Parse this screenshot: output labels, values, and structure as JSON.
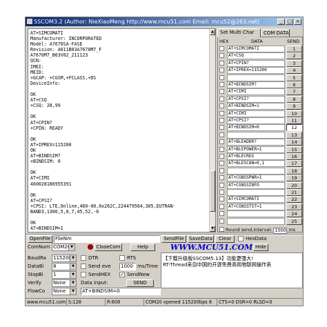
{
  "window": {
    "title": "SSCOM3.2 (Author: NieXiaoMeng  http://www.mcu51.com  Email: mcu52@263.net)"
  },
  "receive": {
    "lines": [
      "AT+SIMCOMATI",
      "Manufacturer: INCORPORATED",
      "Model: A7670SA-FASE",
      "Revision: A011B03A7670M7_F",
      "A7670M7_B03V02_211123",
      "QCN:",
      "IMEI:",
      "MEID:",
      "+GCAP: +CGSM,+FCLASS,+DS",
      "DeviceInfo:",
      "",
      "OK",
      "AT+CSQ",
      "+CSQ: 28,99",
      "",
      "OK",
      "AT+CPIN?",
      "+CPIN: READY",
      "",
      "OK",
      "AT+IPREX=115200",
      "OK",
      "AT+BINDSIM?",
      "+BINDSIM: 0",
      "",
      "OK",
      "AT+CIMI",
      "460028186955391",
      "",
      "OK",
      "AT+CPSI?",
      "+CPSI: LTE,Online,460-00,0x262C,224479564,305,EUTRAN-",
      "BAND3,1300,5,0,7,45,52,-6",
      "",
      "OK",
      "AT+BINDSIM=1",
      "OK"
    ]
  },
  "multi": {
    "tabs": [
      "Set Multi Char",
      "COM DATA"
    ],
    "headers": {
      "hex": "HEX",
      "data": "DATA",
      "send": "SEND"
    },
    "rows": [
      {
        "data": "AT+SIMCOMATI",
        "num": "1"
      },
      {
        "data": "AT+CSQ",
        "num": "2"
      },
      {
        "data": "AT+CPIN?",
        "num": "3"
      },
      {
        "data": "AT+IPREX=115200",
        "num": "4"
      },
      {
        "data": "",
        "num": "5"
      },
      {
        "data": "AT+BINDSIM?",
        "num": "6"
      },
      {
        "data": "AT+CIMI",
        "num": "7"
      },
      {
        "data": "AT+CPSI?",
        "num": "8"
      },
      {
        "data": "AT+BINDSIM=1",
        "num": "9"
      },
      {
        "data": "AT+CIMI",
        "num": "10"
      },
      {
        "data": "AT+CPSI?",
        "num": "11"
      },
      {
        "data": "AT+BINDSIM=0",
        "num": "12"
      },
      {
        "data": "",
        "num": "13"
      },
      {
        "data": "AT+BLEADDR?",
        "num": "14"
      },
      {
        "data": "AT+BLEPOWER=1",
        "num": "15"
      },
      {
        "data": "AT+BLECREG",
        "num": "16"
      },
      {
        "data": "AT+BLESCAN=0,1",
        "num": "17"
      },
      {
        "data": "",
        "num": "18"
      },
      {
        "data": "AT+CGNSSPWR=1",
        "num": "19"
      },
      {
        "data": "AT+CGNSSINFO",
        "num": "20"
      },
      {
        "data": "",
        "num": "21"
      },
      {
        "data": "AT+SIMCOMATI",
        "num": "22"
      },
      {
        "data": "AT+CGNSSTST=1",
        "num": "23"
      },
      {
        "data": "",
        "num": "24"
      },
      {
        "data": "",
        "num": "25"
      }
    ],
    "round": {
      "label": "Round send,interval:",
      "value": "1000",
      "unit": "ms"
    }
  },
  "controls": {
    "openfile": "OpenFile",
    "filename": "FileNm",
    "sendfile": "SendFile",
    "savedata": "SaveData",
    "clear": "Clear",
    "hexdata": "HexData",
    "comnum_label": "ComNum",
    "comnum": "COM20",
    "closecom": "CloseCom",
    "help": "Help",
    "logo": "WWW.MCU51.COM",
    "hide": "Hide",
    "baud_label": "BaudRa",
    "baud": "115200",
    "databit_label": "DataBi",
    "databit": "8",
    "stopbit_label": "StopBi",
    "stopbit": "1",
    "verify_label": "Verify",
    "verify": "None",
    "flow_label": "FlowCo",
    "flow": "None",
    "dtr": "DTR",
    "rts": "RTS",
    "send_eve": "Send eve",
    "interval": "1000",
    "interval_unit": "ms/Time",
    "sendhex": "SendHEX",
    "sendnew": "SendNew",
    "data_input_label": "Data input:",
    "send_btn": "SEND",
    "data_input": "AT+BINDSIM=0"
  },
  "promo": {
    "lines": [
      "【下载升级版SSCOM5.13】功能更强大!",
      "RT-Thread来自中国的开源免费商用物联网操作系"
    ]
  },
  "status": {
    "site": "www.mcu51.com",
    "s": "S:128",
    "r": "R:608",
    "port": "COM20 opened 115200bps 8",
    "lines": "CTS=0 DSR=0 RLSD=0"
  }
}
